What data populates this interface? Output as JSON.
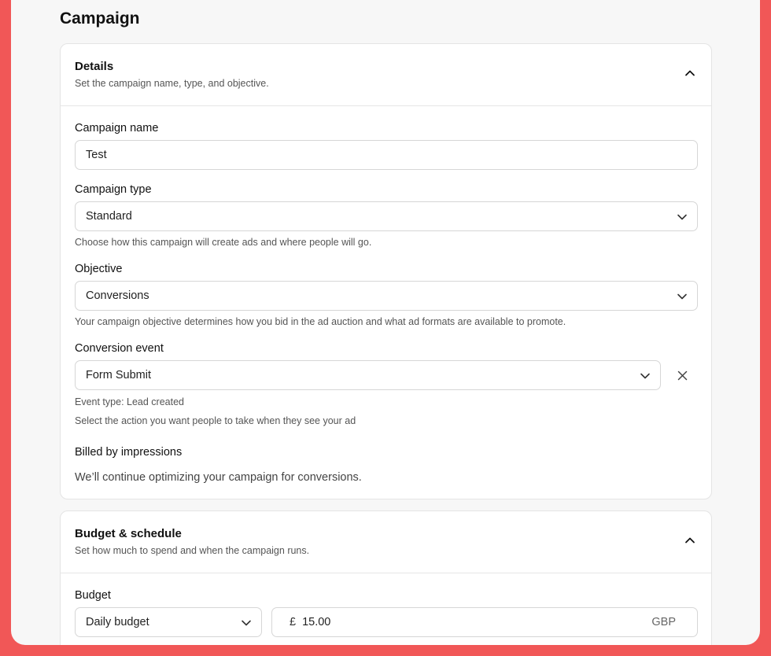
{
  "page": {
    "title": "Campaign"
  },
  "details": {
    "title": "Details",
    "subtitle": "Set the campaign name, type, and objective.",
    "collapse_icon": "chevron-up-icon",
    "campaign_name": {
      "label": "Campaign name",
      "value": "Test"
    },
    "campaign_type": {
      "label": "Campaign type",
      "value": "Standard",
      "help": "Choose how this campaign will create ads and where people will go."
    },
    "objective": {
      "label": "Objective",
      "value": "Conversions",
      "help": "Your campaign objective determines how you bid in the ad auction and what ad formats are available to promote."
    },
    "conversion_event": {
      "label": "Conversion event",
      "value": "Form Submit",
      "event_type": "Event type: Lead created",
      "help": "Select the action you want people to take when they see your ad"
    },
    "billing": {
      "label": "Billed by impressions",
      "info": "We’ll continue optimizing your campaign for conversions."
    }
  },
  "budget_schedule": {
    "title": "Budget & schedule",
    "subtitle": "Set how much to spend and when the campaign runs.",
    "collapse_icon": "chevron-up-icon",
    "budget": {
      "label": "Budget",
      "type_value": "Daily budget",
      "currency_symbol": "£",
      "amount": "15.00",
      "currency_code": "GBP"
    }
  },
  "colors": {
    "border_frame": "#f15757",
    "background": "#f7f7f7",
    "card": "#ffffff"
  }
}
